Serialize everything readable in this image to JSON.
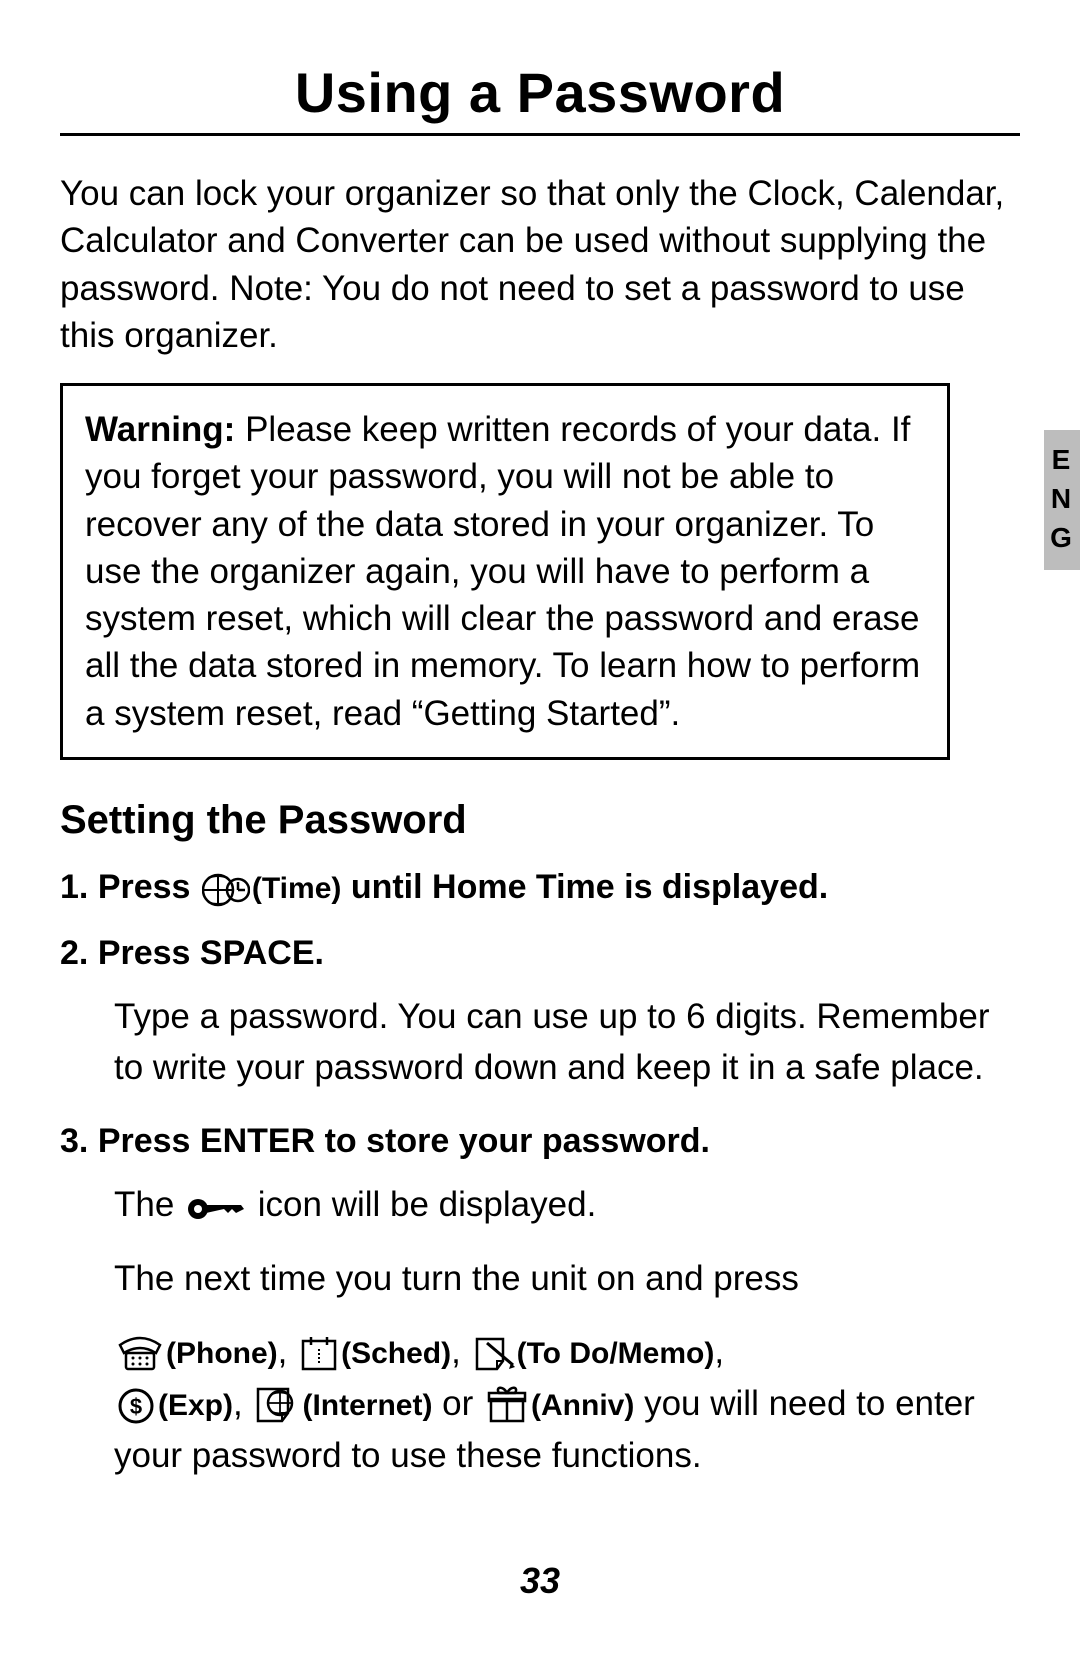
{
  "title": "Using a Password",
  "intro": "You can lock your organizer so that only the Clock, Calendar, Calculator and Converter can be used without supplying the password. Note: You do not need to set a password to use this organizer.",
  "warning": {
    "lead": "Warning:",
    "text": " Please keep written records of your data. If you forget your password, you will not be able to recover any of the data stored in your organizer. To use the organizer again, you will have to perform a system reset, which will clear the password and erase all the data stored in memory. To learn how to perform a system reset, read “Getting Started”."
  },
  "lang_tab": "E\nN\nG",
  "subtitle": "Setting the Password",
  "steps": {
    "s1": {
      "num": "1. ",
      "a": "Press ",
      "icon_label": "(Time)",
      "b": " until Home Time is displayed."
    },
    "s2": {
      "num": "2. ",
      "a": "Press SPACE."
    },
    "s2_body": "Type a password. You can use up to 6 digits. Remember to write your password down and keep it in a safe place.",
    "s3": {
      "num": "3. ",
      "a": "Press ENTER to store your password."
    },
    "s3_body1_a": "The ",
    "s3_body1_b": " icon will be displayed.",
    "s3_body2": "The next time you turn the unit on and press",
    "icons": {
      "phone": "(Phone)",
      "sched": "(Sched)",
      "todo": "(To Do/Memo)",
      "exp": "(Exp)",
      "internet": "(Internet)",
      "anniv": "(Anniv)"
    },
    "sep_comma": ", ",
    "sep_or": " or ",
    "s3_tail": " you will need to enter your password to use these functions."
  },
  "page_number": "33"
}
